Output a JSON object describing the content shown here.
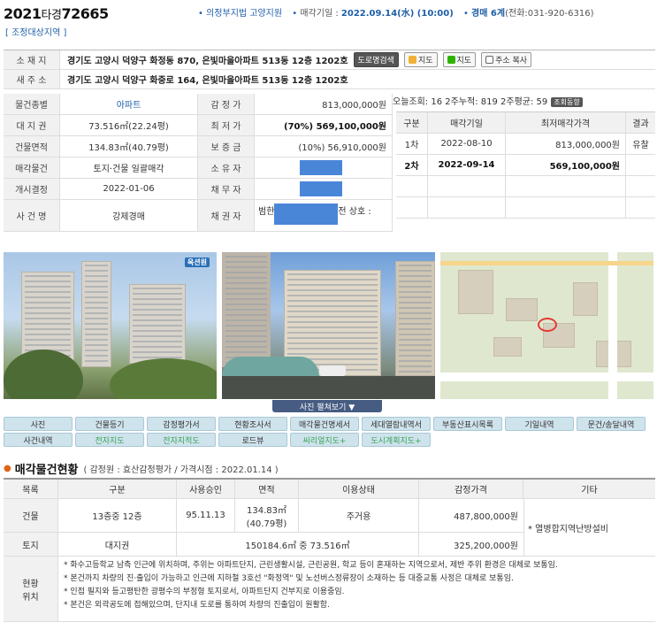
{
  "header": {
    "case_year": "2021",
    "case_tag": "타경",
    "case_num": "72665",
    "court": "의정부지법 고양지원",
    "auction_date_label": "매각기일 :",
    "auction_date": "2022.09.14(水) (10:00)",
    "dept": "경매 6계",
    "phone": "(전화:031-920-6316)",
    "zone_link": "[ 조정대상지역 ]"
  },
  "info": {
    "addr_label": "소 재 지",
    "addr": "경기도 고양시 덕양구 화정동 870, 은빛마을아파트 513동 12층 1202호",
    "road_btn": "도로명검색",
    "map_btn1": "지도",
    "map_btn2": "지도",
    "copy_btn": "주소 복사",
    "new_addr_label": "새 주 소",
    "new_addr": "경기도 고양시 덕양구 화중로 164, 은빛마을아파트 513동 12층 1202호"
  },
  "grid": {
    "r1": {
      "l1": "물건종별",
      "v1": "아파트",
      "l2": "감 정 가",
      "v2": "813,000,000원"
    },
    "r2": {
      "l1": "대 지 권",
      "v1": "73.516㎡(22.24평)",
      "l2": "최 저 가",
      "v2": "(70%) 569,100,000원"
    },
    "r3": {
      "l1": "건물면적",
      "v1": "134.83㎡(40.79평)",
      "l2": "보 증 금",
      "v2": "(10%) 56,910,000원"
    },
    "r4": {
      "l1": "매각물건",
      "v1": "토지·건물 일괄매각",
      "l2": "소 유 자"
    },
    "r5": {
      "l1": "개시결정",
      "v1": "2022-01-06",
      "l2": "채 무 자"
    },
    "r6": {
      "l1": "사 건 명",
      "v1": "강제경매",
      "l2": "채 권 자",
      "v2a": "범한",
      "v2b": "전 상호 :"
    }
  },
  "bids": {
    "views": "오늘조회: 16  2주누적: 819  2주평균: 59",
    "views_btn": "조회동향",
    "head": [
      "구분",
      "매각기일",
      "최저매각가격",
      "결과"
    ],
    "rows": [
      {
        "no": "1차",
        "date": "2022-08-10",
        "price": "813,000,000원",
        "result": "유찰"
      },
      {
        "no": "2차",
        "date": "2022-09-14",
        "price": "569,100,000원",
        "result": ""
      }
    ]
  },
  "photo_bar": "사진 펼쳐보기 ▼",
  "photo_watermark": "옥션원",
  "tabs": {
    "row1": [
      "사진",
      "건물등기",
      "감정평가서",
      "현황조사서",
      "매각물건명세서",
      "세대열람내역서",
      "부동산표시목록",
      "기일내역",
      "문건/송달내역"
    ],
    "row2": [
      "사건내역",
      "전자지도",
      "전자지적도",
      "로드뷰",
      "씨리얼지도+",
      "도시계획지도+"
    ]
  },
  "section": {
    "title": "매각물건현황",
    "sub": "( 감정원 : 효산감정평가 / 가격시점 : 2022.01.14 )"
  },
  "ptable": {
    "head": [
      "목록",
      "구분",
      "사용승인",
      "면적",
      "이용상태",
      "감정가격",
      "기타"
    ],
    "building": {
      "c1": "건물",
      "c2": "13층중 12층",
      "c3": "95.11.13",
      "c4a": "134.83㎡",
      "c4b": "(40.79평)",
      "c5": "주거용",
      "c6": "487,800,000원"
    },
    "land": {
      "c1": "토지",
      "c2": "대지권",
      "c4": "150184.6㎡ 중 73.516㎡",
      "c6": "325,200,000원"
    },
    "etc": "* 열병합지역난방설비",
    "loc_label1": "현황",
    "loc_label2": "위치",
    "notes": [
      "* 화수고등학교 남측 인근에 위치하며, 주위는 아파트단지, 근린생활시설, 근린공원, 학교 등이 혼재하는 지역으로서, 제반 주위 환경은 대체로 보통임.",
      "* 본건까지 차량의 진·출입이 가능하고 인근에 지하철 3호선 \"화정역\" 및 노선버스정류장이 소재하는 등 대중교통 사정은 대체로 보통임.",
      "* 인접 필지와 등고평탄한 광평수의 부정형 토지로서, 아파트단지 건부지로 이용중임.",
      "* 본건은 외곽공도에 접해있으며, 단지내 도로를 통하여 차량의 진출입이 원활함."
    ]
  }
}
